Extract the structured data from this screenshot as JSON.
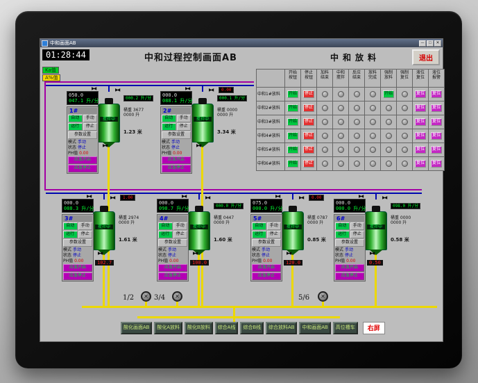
{
  "colors": {
    "accent_green": "#00c840",
    "accent_red": "#e43030",
    "magenta": "#c428c4",
    "pipe_yellow": "#ecd800",
    "pipe_blue": "#0008b0",
    "pipe_purple": "#a300a3",
    "tank_green": "#2fae2f"
  },
  "window": {
    "title": "中和画面AB",
    "min": "─",
    "max": "□",
    "close": "✕"
  },
  "header": {
    "time": "01:28:44",
    "title": "中和过程控制画面AB",
    "right_title": "中和放料",
    "exit_label": "退出"
  },
  "indicators": {
    "ka": "Ka值",
    "a_pct": "A%值"
  },
  "status_table": {
    "col_headers": [
      "开始按钮",
      "停止按钮",
      "加料结束",
      "中和搅拌",
      "反应结束",
      "放料完成",
      "强制放料",
      "强制复位",
      "液位复位",
      "液位报警"
    ],
    "labels": {
      "start": "开始",
      "stop": "停止",
      "go": "开始",
      "reset": "复位"
    },
    "rows": [
      {
        "label": "中和1#放料",
        "cells": [
          "start",
          "stop",
          "lamp",
          "lamp",
          "lamp",
          "lamp",
          "go",
          "lamp",
          "reset",
          "reset"
        ]
      },
      {
        "label": "中和2#放料",
        "cells": [
          "start",
          "stop",
          "lamp",
          "lamp",
          "lamp",
          "lamp",
          "lamp",
          "lamp",
          "reset",
          "reset"
        ]
      },
      {
        "label": "中和3#放料",
        "cells": [
          "start",
          "stop",
          "lamp",
          "lamp",
          "lamp",
          "lamp",
          "lamp",
          "lamp",
          "reset",
          "reset"
        ]
      },
      {
        "label": "中和4#放料",
        "cells": [
          "start",
          "stop",
          "lamp",
          "lamp",
          "lamp",
          "lamp",
          "lamp",
          "lamp",
          "reset",
          "reset"
        ]
      },
      {
        "label": "中和5#放料",
        "cells": [
          "start",
          "stop",
          "lamp",
          "lamp",
          "lamp",
          "lamp",
          "lamp",
          "lamp",
          "reset",
          "reset"
        ]
      },
      {
        "label": "中和6#放料",
        "cells": [
          "start",
          "stop",
          "lamp",
          "lamp",
          "lamp",
          "lamp",
          "lamp",
          "lamp",
          "reset",
          "reset"
        ]
      }
    ]
  },
  "panel": {
    "auto": "自动",
    "manual": "手动",
    "run": "运行",
    "stop": "停止",
    "params": "参数设置",
    "mode_label": "模式",
    "mode_value": "手动",
    "state_label": "状态",
    "state_value": "停止",
    "ph_label": "PH值",
    "ph_value": "0.00",
    "em_open": "应急开启",
    "em_stop": "应急停止"
  },
  "units": [
    {
      "id": "1#",
      "status": "搅拌中",
      "flow_sp": "050.0",
      "flow_pv": "047.1 升/分",
      "flow2": "000.2 升/分",
      "aux": "",
      "ro1": "桶重 3677",
      "ro2": "0000 升",
      "level": "1.23 米",
      "bottom": ""
    },
    {
      "id": "2#",
      "status": "搅拌中",
      "flow_sp": "000.0",
      "flow_pv": "088.1 升/分",
      "flow2": "000.1 升/分",
      "aux": "0.00",
      "ro1": "桶重 0000",
      "ro2": "0000 升",
      "level": "3.34 米",
      "bottom": ""
    },
    {
      "id": "3#",
      "status": "搅拌中",
      "flow_sp": "000.0",
      "flow_pv": "088.3 升/分",
      "flow2": "",
      "aux": "1.00",
      "ro1": "桶重 2974",
      "ro2": "0000 升",
      "level": "1.61 米",
      "bottom": "102.7"
    },
    {
      "id": "4#",
      "status": "搅拌中",
      "flow_sp": "000.0",
      "flow_pv": "098.7 升/分",
      "flow2": "000.0 升/分",
      "aux": "",
      "ro1": "桶重 0447",
      "ro2": "0000 升",
      "level": "1.60 米",
      "bottom": "100.0"
    },
    {
      "id": "5#",
      "status": "搅拌中",
      "flow_sp": "075.0",
      "flow_pv": "000.0 升/分",
      "flow2": "",
      "aux": "0.00",
      "ro1": "桶重 0787",
      "ro2": "0000 升",
      "level": "0.85 米",
      "bottom": "120.0"
    },
    {
      "id": "6#",
      "status": "搅拌中",
      "flow_sp": "000.0",
      "flow_pv": "000.0 升/分",
      "flow2": "098.0 升/分",
      "aux": "",
      "ro1": "桶重 0000",
      "ro2": "0000 升",
      "level": "0.58 米",
      "bottom": "0.50"
    }
  ],
  "pumps": {
    "labels": [
      "1/2",
      "3/4",
      "5/6"
    ]
  },
  "nav": {
    "buttons": [
      "酸化画面AB",
      "酸化A放料",
      "酸化B放料",
      "综合A线",
      "综合B线",
      "综合放料AB",
      "中和画面AB",
      "高位槽车"
    ],
    "right_label": "右屏"
  }
}
